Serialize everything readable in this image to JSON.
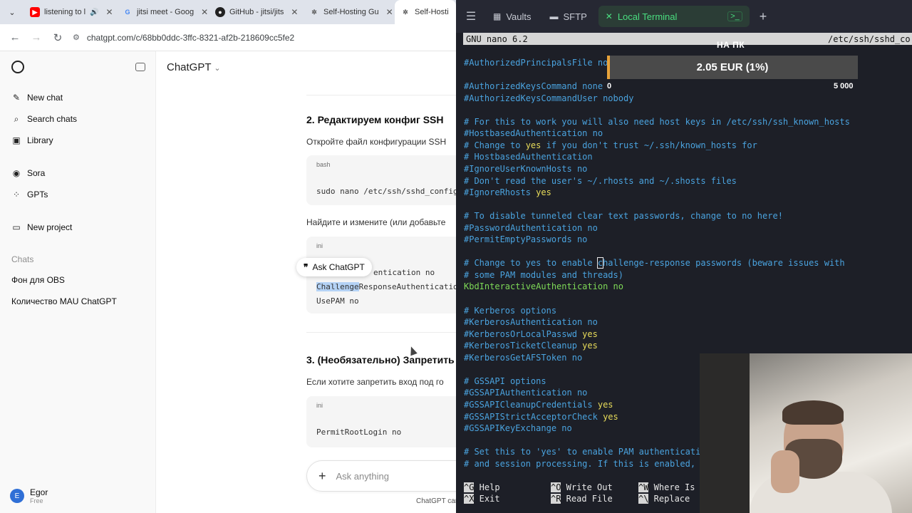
{
  "browser": {
    "tabs": [
      {
        "title": "listening to l",
        "icon": "youtube-icon"
      },
      {
        "title": "jitsi meet - Goog",
        "icon": "google-icon"
      },
      {
        "title": "GitHub - jitsi/jits",
        "icon": "github-icon"
      },
      {
        "title": "Self-Hosting Gu",
        "icon": "chatgpt-icon"
      },
      {
        "title": "Self-Hosti",
        "icon": "chatgpt-icon"
      }
    ],
    "url": "chatgpt.com/c/68bb0ddc-3ffc-8321-af2b-218609cc5fe2"
  },
  "sidebar": {
    "items": [
      {
        "label": "New chat",
        "icon": "pencil-icon"
      },
      {
        "label": "Search chats",
        "icon": "search-icon"
      },
      {
        "label": "Library",
        "icon": "library-icon"
      },
      {
        "label": "Sora",
        "icon": "sora-icon"
      },
      {
        "label": "GPTs",
        "icon": "grid-icon"
      },
      {
        "label": "New project",
        "icon": "folder-plus-icon"
      }
    ],
    "section_label": "Chats",
    "chats": [
      "Фон для OBS",
      "Количество MAU ChatGPT"
    ],
    "user": {
      "initial": "E",
      "name": "Egor",
      "plan": "Free"
    }
  },
  "chat": {
    "model": "ChatGPT",
    "step2_title": "2. Редактируем конфиг SSH",
    "step2_text": "Откройте файл конфигурации SSH",
    "code1_lang": "bash",
    "code1_line": "sudo nano /etc/ssh/sshd_config",
    "find_text": "Найдите и измените (или добавьте",
    "code2_lang": "ini",
    "code2_line1": "entication no",
    "code2_line2_hl": "Challenge",
    "code2_line2_rest": "ResponseAuthentication",
    "code2_line3": "UsePAM no",
    "ask_popup": "Ask ChatGPT",
    "step3_title": "3. (Необязательно) Запретить",
    "step3_text": "Если хотите запретить вход под го",
    "code3_lang": "ini",
    "code3_line": "PermitRootLogin no",
    "composer_placeholder": "Ask anything",
    "footnote": "ChatGPT can"
  },
  "terminal": {
    "tabs": {
      "vaults": "Vaults",
      "sftp": "SFTP",
      "local": "Local Terminal"
    },
    "nano_version": "GNU nano 6.2",
    "file_path": "/etc/ssh/sshd_co",
    "lines": {
      "l1": "#AuthorizedPrincipalsFile no",
      "l2": "#AuthorizedKeysCommand none",
      "l3": "#AuthorizedKeysCommandUser nobody",
      "l4": "# For this to work you will also need host keys in /etc/ssh/ssh_known_hosts",
      "l5": "#HostbasedAuthentication no",
      "l6a": "# Change to ",
      "l6b": "yes",
      "l6c": " if you don't trust ~/.ssh/known_hosts for",
      "l7": "# HostbasedAuthentication",
      "l8": "#IgnoreUserKnownHosts no",
      "l9": "# Don't read the user's ~/.rhosts and ~/.shosts files",
      "l10a": "#IgnoreRhosts ",
      "l10b": "yes",
      "l11": "# To disable tunneled clear text passwords, change to no here!",
      "l12": "#PasswordAuthentication no",
      "l13": "#PermitEmptyPasswords no",
      "l14a": "# Change to yes to enable ",
      "l14b": "c",
      "l14c": "hallenge-response passwords (beware issues with",
      "l15": "# some PAM modules and threads)",
      "l16": "KbdInteractiveAuthentication no",
      "l17": "# Kerberos options",
      "l18": "#KerberosAuthentication no",
      "l19a": "#KerberosOrLocalPasswd ",
      "l19b": "yes",
      "l20a": "#KerberosTicketCleanup ",
      "l20b": "yes",
      "l21": "#KerberosGetAFSToken no",
      "l22": "# GSSAPI options",
      "l23": "#GSSAPIAuthentication no",
      "l24a": "#GSSAPICleanupCredentials ",
      "l24b": "yes",
      "l25a": "#GSSAPIStrictAcceptorCheck ",
      "l25b": "yes",
      "l26": "#GSSAPIKeyExchange no",
      "l27": "# Set this to 'yes' to enable PAM authenticati",
      "l28": "# and session processing. If this is enabled,"
    },
    "shortcuts": [
      {
        "key": "^G",
        "label": " Help"
      },
      {
        "key": "^X",
        "label": " Exit"
      },
      {
        "key": "^O",
        "label": " Write Out"
      },
      {
        "key": "^R",
        "label": " Read File"
      },
      {
        "key": "^W",
        "label": " Where Is"
      },
      {
        "key": "^\\",
        "label": " Replace"
      }
    ]
  },
  "donation": {
    "title": "НА ПК",
    "amount_label": "2.05 EUR (1%)",
    "progress_fraction": 0.01,
    "min_label": "0",
    "max_label": "5 000",
    "fill_color": "#e8a33a"
  }
}
